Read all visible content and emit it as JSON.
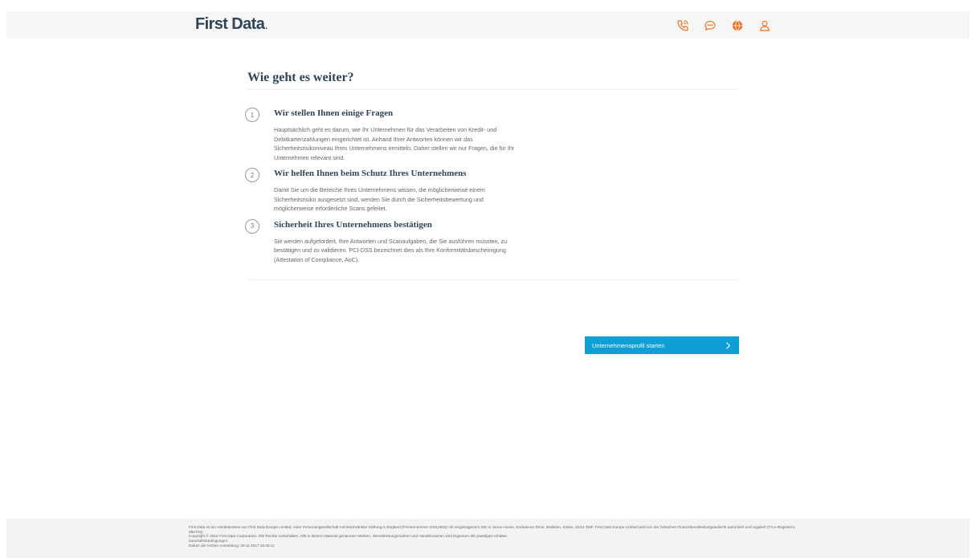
{
  "header": {
    "logo_text": "First Data",
    "logo_dot": ".",
    "icons": [
      {
        "name": "phone-icon",
        "color": "#f36f21"
      },
      {
        "name": "chat-icon",
        "color": "#f36f21"
      },
      {
        "name": "globe-icon",
        "color": "#f36f21"
      },
      {
        "name": "user-icon",
        "color": "#f36f21"
      }
    ]
  },
  "main": {
    "title": "Wie geht es weiter?",
    "steps": [
      {
        "number": "1",
        "title": "Wir stellen Ihnen einige Fragen",
        "text": "Hauptsächlich geht es darum, wie Ihr Unternehmen für das Verarbeiten von Kredit- und Debitkartenzahlungen eingerichtet ist. Anhand Ihrer Antworten können wir das Sicherheitsrisikoniveau Ihres Unternehmens ermitteln. Daher stellen wir nur Fragen, die für Ihr Unternehmen relevant sind."
      },
      {
        "number": "2",
        "title": "Wir helfen Ihnen beim Schutz Ihres Unternehmens",
        "text": "Damit Sie um die Bereiche Ihres Unternehmens wissen, die möglicherweise einem Sicherheitsrisiko ausgesetzt sind, werden Sie durch die Sicherheitsbewertung und möglicherweise erforderliche Scans geleitet."
      },
      {
        "number": "3",
        "title": "Sicherheit Ihres Unternehmens bestätigen",
        "text": "Sie werden aufgefordert, Ihre Antworten und Scanaufgaben, die Sie ausführen mussten, zu bestätigen und zu validieren. PCI-DSS bezeichnet dies als Ihre Konformitätsbescheinigung (Attestation of Compliance, AoC)."
      }
    ],
    "start_button_label": "Unternehmensprofil starten"
  },
  "footer": {
    "legal": "First Data ist ein Handelsname von First Data Europe Limited, einer Personengesellschaft mit beschränkter Haftung in England (Firmennummer 02012925) mit eingetragenem Sitz in Janus House, Endeavour Drive, Basildon, Essex, SS14 3WF. First Data Europe Limited wird von der britischen Finanzdienstleistungsaufsicht autorisiert und reguliert (FCA-Registernr. 582703).",
    "copyright": "Copyright © 2016 First Data Corporation. Alle Rechte vorbehalten. Alle in diesem Material genannten Marken, Dienstleistungsmarken und Handelsnamen sind Eigentum der jeweiligen Inhaber.",
    "terms_link": "Geschäftsbedingungen",
    "last_login": "Datum der letzten Anmeldung: 29.11.2017 15:48:11"
  },
  "colors": {
    "brand_navy": "#2f4457",
    "accent_orange": "#f36f21",
    "button_blue": "#0f9fd6"
  }
}
